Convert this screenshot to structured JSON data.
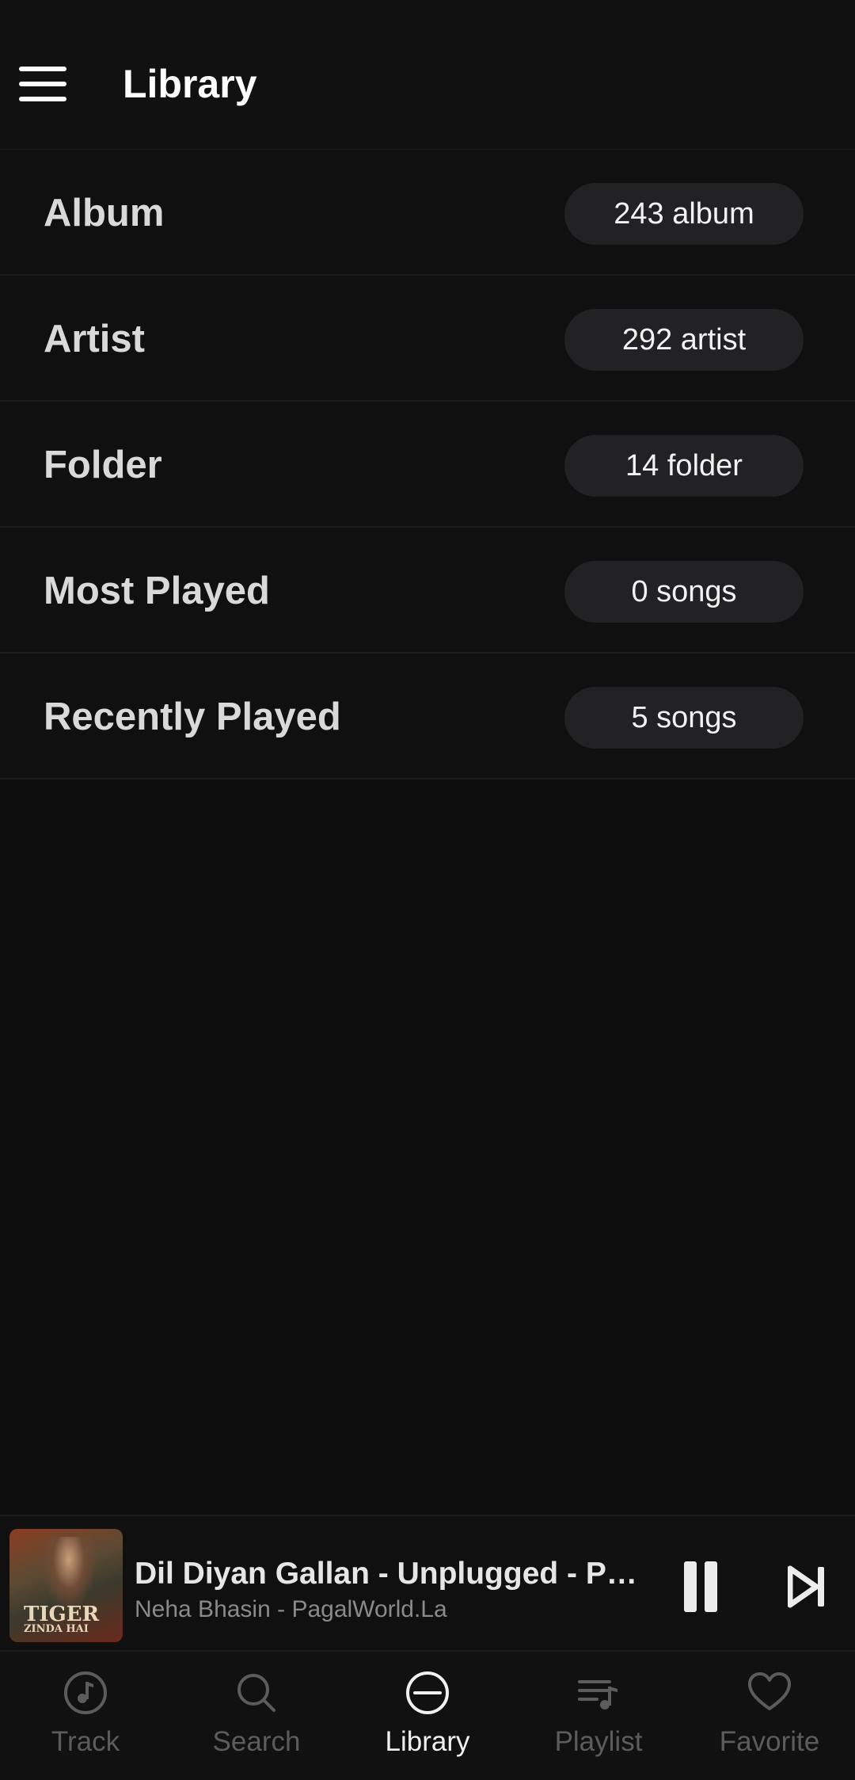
{
  "header": {
    "menu_icon": "hamburger-menu-icon",
    "title": "Library"
  },
  "library": {
    "items": [
      {
        "label": "Album",
        "count": "243 album"
      },
      {
        "label": "Artist",
        "count": "292 artist"
      },
      {
        "label": "Folder",
        "count": "14 folder"
      },
      {
        "label": "Most Played",
        "count": "0 songs"
      },
      {
        "label": "Recently Played",
        "count": "5 songs"
      }
    ]
  },
  "now_playing": {
    "title": "Dil Diyan Gallan - Unplugged - PagalWorld.La",
    "artist": "Neha Bhasin - PagalWorld.La",
    "art_text": "TIGER",
    "art_subtext": "ZINDA HAI",
    "state": "playing"
  },
  "bottom_nav": {
    "items": [
      {
        "label": "Track",
        "icon": "music-note-icon",
        "active": false
      },
      {
        "label": "Search",
        "icon": "search-icon",
        "active": false
      },
      {
        "label": "Library",
        "icon": "library-icon",
        "active": true
      },
      {
        "label": "Playlist",
        "icon": "playlist-icon",
        "active": false
      },
      {
        "label": "Favorite",
        "icon": "heart-icon",
        "active": false
      }
    ]
  },
  "colors": {
    "background": "#0e0e0e",
    "badge": "#222224",
    "active_nav": "#f0f0f0",
    "inactive_nav": "#5c5c5c"
  }
}
